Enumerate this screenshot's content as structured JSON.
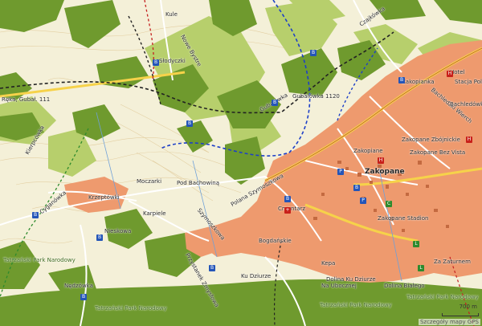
{
  "map": {
    "scale_label": "700 m",
    "footer": "Szczegóły mapy GPS",
    "places": [
      "Kule",
      "Słodyczki",
      "Nowe Bystre",
      "Czajkówka",
      "Bachledzki Wierch",
      "Gubałówka 1120",
      "Gubałówka",
      "Ręka, Gubał. 111",
      "Nędzówka",
      "Zakopane",
      "Zakopiane",
      "Bogdańskie",
      "Polana Szymoszkowa",
      "Pod Bachowiną",
      "Moczarki",
      "Kierpcówka",
      "Krzeptówki",
      "Cyganówka",
      "Szymoszkowa",
      "Przystanek Zmysłowa",
      "Kepa",
      "Karpiele",
      "Nieskowa",
      "Bachledówka",
      "Na Ubocznej",
      "Tatrzański Park Narodowy",
      "Tatrzański Park Narodowy",
      "Tatrzański Park Narodowy",
      "Dolina Ku Dziurze",
      "Dolina Białego",
      "Cmentarz",
      "Zakopane Zbójnickie",
      "Zakopane Bez Vista",
      "Stacja Polar",
      "Zakopane Stadion",
      "Za Zaturnem",
      "Tatrzański Park Narodowy",
      "Hotel",
      "Zakopianka",
      "Ku Dziurze"
    ]
  },
  "colors": {
    "land": "#f4f0d8",
    "forest": "#6f9a2e",
    "meadow": "#b7cf6c",
    "urban": "#ee9a6e",
    "road_minor": "#ffffff",
    "road_main": "#f6d24a",
    "trail_black": "#222222",
    "trail_blue": "#1d3fc8",
    "trail_red": "#c42020"
  },
  "icons": [
    "bus-stop-icon",
    "church-icon",
    "hotel-icon",
    "parking-icon",
    "cable-car-icon",
    "lift-icon"
  ]
}
